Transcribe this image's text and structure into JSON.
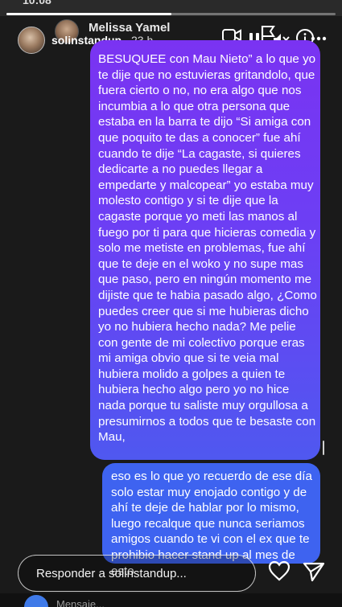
{
  "underlying_chat": {
    "status_time": "10:08",
    "contact_name": "Melissa Yamel",
    "compose_placeholder": "Mensaje..."
  },
  "story": {
    "username": "solinstandup",
    "time_ago": "23 h",
    "progress_fraction": 0.5
  },
  "messages": [
    {
      "text": "BESUQUEE con Mau Nieto” a lo que yo te dije que no estuvieras gritandolo, que fuera cierto o no, no era algo que nos incumbia a lo que otra persona que estaba en la barra te dijo “Si amiga con que poquito te das a conocer” fue ahí cuando te dije “La cagaste, si quieres dedicarte a no puedes llegar a empedarte y malcopear” yo estaba muy molesto contigo y si te dije que la cagaste porque yo meti las manos al fuego por ti para que hicieras comedia y solo me metiste en problemas, fue ahí que te deje en el woko y no supe mas que paso, pero en ningún momento me dijiste que te habia pasado algo, ¿Como puedes creer que si me hubieras dicho yo no hubiera hecho nada? Me pelie con gente de mi colectivo porque eras mi amiga obvio que si te veia mal hubiera molido a golpes a quien te hubiera hecho algo pero yo no hice nada porque tu saliste muy orgullosa a presumirnos a todos que te besaste con Mau,"
    },
    {
      "text": "eso es lo que yo recuerdo de ese día solo estar muy enojado contigo y de ahí te deje de hablar por lo mismo, luego recalque que nunca seriamos amigos cuando te vi con el ex que te prohibio hacer stand up al mes de esto"
    }
  ],
  "reply": {
    "placeholder": "Responder a solinstandup..."
  },
  "icons": [
    "camera-icon",
    "pause-icon",
    "mute-icon",
    "info-icon",
    "more-icon",
    "heart-icon",
    "send-icon",
    "flag-icon",
    "video-icon"
  ],
  "colors": {
    "purple_top": "#7a33f2",
    "purple_bottom": "#4f58f0",
    "blue_bubble": "#3e63f0"
  }
}
